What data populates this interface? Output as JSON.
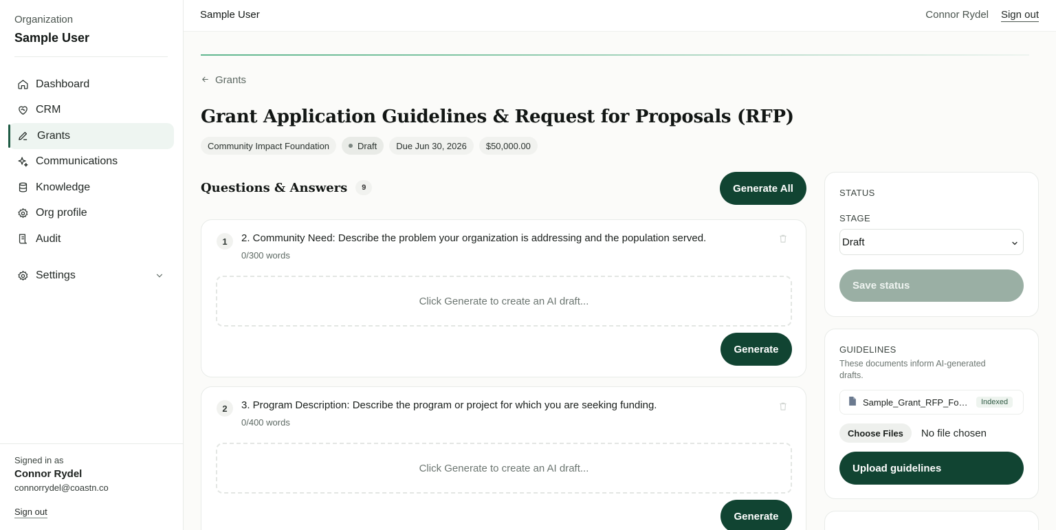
{
  "sidebar": {
    "org_label": "Organization",
    "org_name": "Sample User",
    "nav": [
      {
        "label": "Dashboard",
        "icon": "home-icon"
      },
      {
        "label": "CRM",
        "icon": "heart-handshake-icon"
      },
      {
        "label": "Grants",
        "icon": "pen-icon",
        "active": true
      },
      {
        "label": "Communications",
        "icon": "sparkles-icon"
      },
      {
        "label": "Knowledge",
        "icon": "database-icon"
      },
      {
        "label": "Org profile",
        "icon": "gear-icon"
      },
      {
        "label": "Audit",
        "icon": "receipt-icon"
      }
    ],
    "settings_label": "Settings",
    "signed_in_label": "Signed in as",
    "user_name": "Connor Rydel",
    "user_email": "connorrydel@coastn.co",
    "signout_label": "Sign out"
  },
  "topbar": {
    "title": "Sample User",
    "user": "Connor Rydel",
    "signout": "Sign out"
  },
  "main": {
    "back_label": "Grants",
    "title": "Grant Application Guidelines & Request for Proposals (RFP)",
    "chips": {
      "funder": "Community Impact Foundation",
      "status": "Draft",
      "due": "Due Jun 30, 2026",
      "amount": "$50,000.00"
    },
    "qa_title": "Questions & Answers",
    "qa_count": "9",
    "generate_all": "Generate All",
    "questions": [
      {
        "num": "1",
        "text": "2. Community Need: Describe the problem your organization is addressing and the population served.",
        "words": "0/300 words",
        "placeholder": "Click Generate to create an AI draft...",
        "generate": "Generate"
      },
      {
        "num": "2",
        "text": "3. Program Description: Describe the program or project for which you are seeking funding.",
        "words": "0/400 words",
        "placeholder": "Click Generate to create an AI draft...",
        "generate": "Generate"
      }
    ]
  },
  "status_panel": {
    "title": "STATUS",
    "stage_label": "STAGE",
    "stage_value": "Draft",
    "save_label": "Save status"
  },
  "guidelines_panel": {
    "title": "GUIDELINES",
    "description": "These documents inform AI-generated drafts.",
    "file_name": "Sample_Grant_RFP_For_Testing.pdf",
    "file_badge": "Indexed",
    "choose_files": "Choose Files",
    "no_file": "No file chosen",
    "upload_label": "Upload guidelines"
  },
  "colors": {
    "primary": "#114432",
    "accent": "#1f5b44",
    "disabled": "#9aafa4"
  }
}
